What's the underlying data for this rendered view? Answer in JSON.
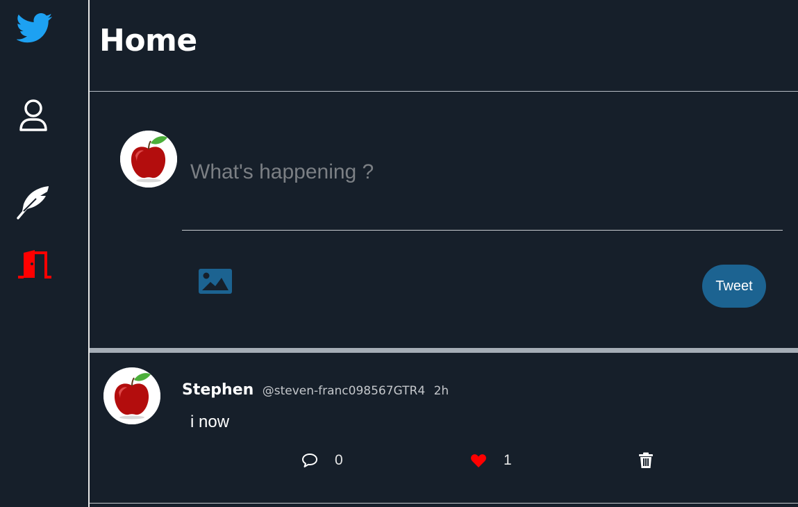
{
  "sidebar": {
    "items": [
      {
        "name": "twitter-logo-icon",
        "color": "#1da1f2"
      },
      {
        "name": "profile-icon",
        "color": "#ffffff"
      },
      {
        "name": "feather-icon",
        "color": "#ffffff"
      },
      {
        "name": "logout-door-icon",
        "color": "#ff0000"
      }
    ]
  },
  "header": {
    "title": "Home"
  },
  "composer": {
    "placeholder": "What's happening ?",
    "value": "",
    "media_icon": "image-icon",
    "tweet_button_label": "Tweet"
  },
  "feed": {
    "tweets": [
      {
        "author_name": "Stephen",
        "author_handle": "@steven-franc098567GTR4",
        "time": "2h",
        "text": "i now",
        "reply_count": "0",
        "like_count": "1"
      }
    ]
  },
  "colors": {
    "background": "#161f2a",
    "accent": "#1c6391",
    "like": "#ff0000",
    "logout": "#ff0000",
    "brand": "#1da1f2"
  }
}
